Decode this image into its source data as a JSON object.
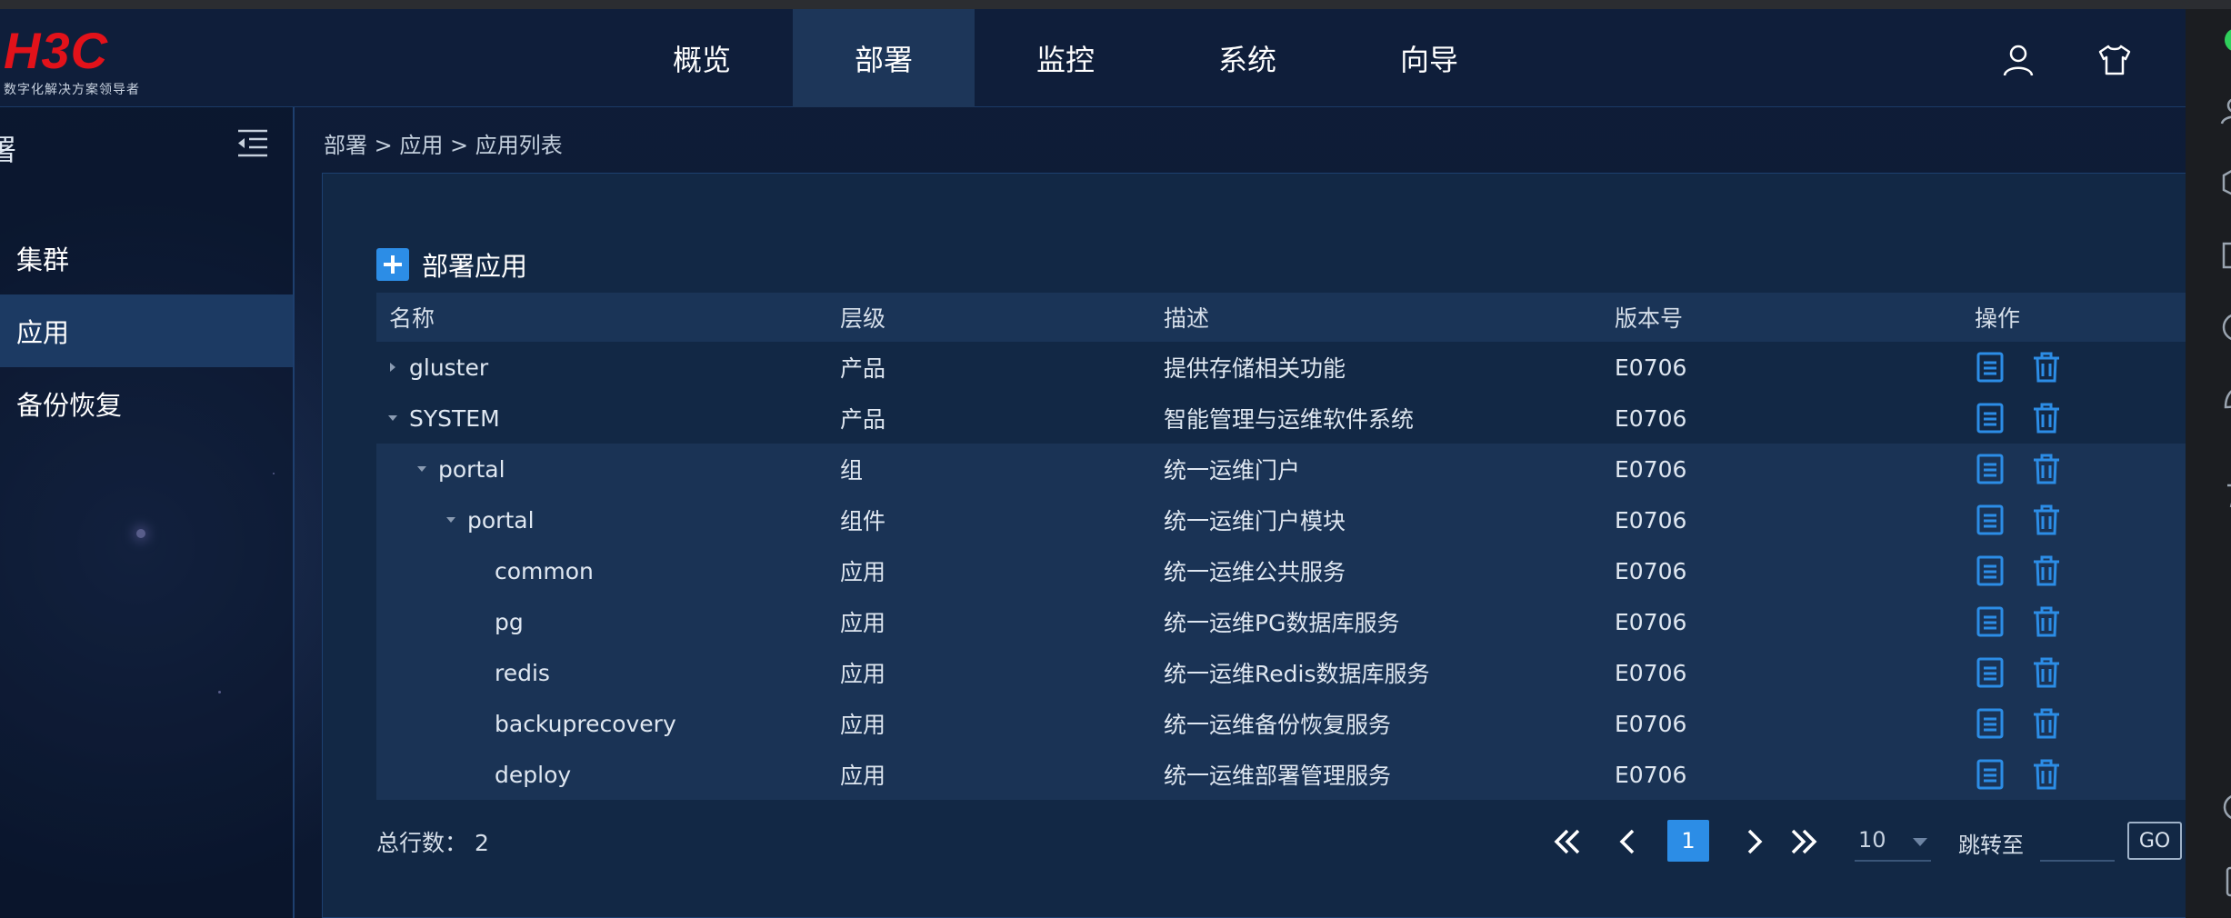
{
  "logo": {
    "brand": "H3C",
    "tagline": "数字化解决方案领导者"
  },
  "nav": {
    "items": [
      {
        "label": "概览",
        "active": false
      },
      {
        "label": "部署",
        "active": true
      },
      {
        "label": "监控",
        "active": false
      },
      {
        "label": "系统",
        "active": false
      },
      {
        "label": "向导",
        "active": false
      }
    ]
  },
  "header_icons": [
    "user-icon",
    "tshirt-skin-icon"
  ],
  "sidebar": {
    "title": "署",
    "items": [
      {
        "label": "集群",
        "active": false
      },
      {
        "label": "应用",
        "active": true
      },
      {
        "label": "备份恢复",
        "active": false
      }
    ]
  },
  "breadcrumb": "部署 > 应用 > 应用列表",
  "toolbar": {
    "add_label": "部署应用"
  },
  "table": {
    "columns": [
      "名称",
      "层级",
      "描述",
      "版本号",
      "操作"
    ],
    "rows": [
      {
        "name": "gluster",
        "level": "产品",
        "desc": "提供存储相关功能",
        "version": "E0706"
      },
      {
        "name": "SYSTEM",
        "level": "产品",
        "desc": "智能管理与运维软件系统",
        "version": "E0706"
      },
      {
        "name": "portal",
        "level": "组",
        "desc": "统一运维门户",
        "version": "E0706"
      },
      {
        "name": "portal",
        "level": "组件",
        "desc": "统一运维门户模块",
        "version": "E0706"
      },
      {
        "name": "common",
        "level": "应用",
        "desc": "统一运维公共服务",
        "version": "E0706"
      },
      {
        "name": "pg",
        "level": "应用",
        "desc": "统一运维PG数据库服务",
        "version": "E0706"
      },
      {
        "name": "redis",
        "level": "应用",
        "desc": "统一运维Redis数据库服务",
        "version": "E0706"
      },
      {
        "name": "backuprecovery",
        "level": "应用",
        "desc": "统一运维备份恢复服务",
        "version": "E0706"
      },
      {
        "name": "deploy",
        "level": "应用",
        "desc": "统一运维部署管理服务",
        "version": "E0706"
      }
    ]
  },
  "pagination": {
    "total_text": "总行数： 2",
    "current_page": "1",
    "page_size": "10",
    "jump_label": "跳转至",
    "jump_value": "",
    "go_label": "GO"
  },
  "colors": {
    "accent": "#2c8de6",
    "header_bg": "#0f1e3a",
    "panel_bg": "#122845",
    "brand_red": "#e2121a"
  }
}
